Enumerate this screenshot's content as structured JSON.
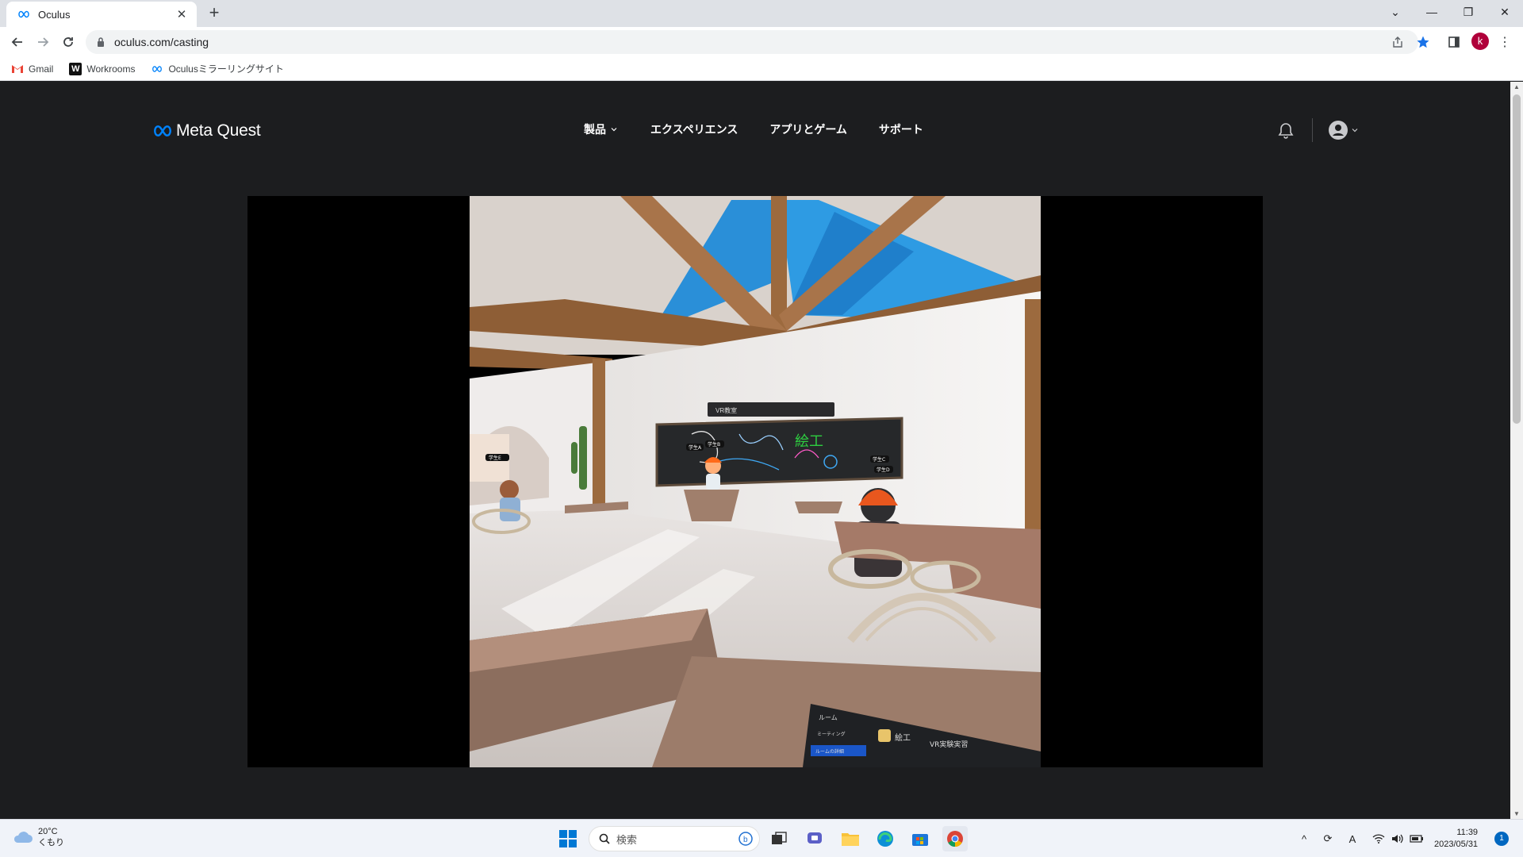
{
  "browser": {
    "tab_title": "Oculus",
    "url": "oculus.com/casting",
    "bookmarks": [
      {
        "label": "Gmail",
        "icon": "gmail-icon"
      },
      {
        "label": "Workrooms",
        "icon": "workrooms-icon"
      },
      {
        "label": "Oculusミラーリングサイト",
        "icon": "meta-icon"
      }
    ],
    "profile_initial": "k"
  },
  "site": {
    "logo_text": "Meta Quest",
    "nav": [
      "製品",
      "エクスペリエンス",
      "アプリとゲーム",
      "サポート"
    ]
  },
  "scene": {
    "board_title": "VR教室",
    "board_text": "絵工",
    "tags": [
      "学生A",
      "学生B",
      "学生C",
      "学生D",
      "学生E"
    ],
    "menu": {
      "items": [
        "ルーム",
        "ミーティング",
        "ルームの詳細"
      ],
      "room_label": "絵工",
      "room_name": "VR実験実習"
    }
  },
  "taskbar": {
    "weather_temp": "20°C",
    "weather_desc": "くもり",
    "search_placeholder": "検索",
    "time": "11:39",
    "date": "2023/05/31",
    "notification_count": "1"
  },
  "colors": {
    "page_bg": "#1c1d1f",
    "meta_blue": "#0082fb",
    "sky": "#2a8fd8"
  }
}
